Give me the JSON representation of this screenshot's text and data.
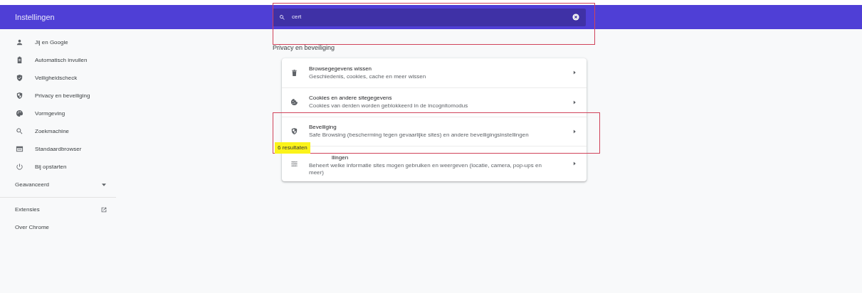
{
  "header": {
    "title": "Instellingen",
    "search": {
      "value": "cert",
      "highlighted": true
    }
  },
  "sidebar": {
    "items": [
      {
        "label": "Jij en Google"
      },
      {
        "label": "Automatisch invullen"
      },
      {
        "label": "Veiligheidscheck"
      },
      {
        "label": "Privacy en beveiliging"
      },
      {
        "label": "Vormgeving"
      },
      {
        "label": "Zoekmachine"
      },
      {
        "label": "Standaardbrowser"
      },
      {
        "label": "Bij opstarten"
      }
    ],
    "advanced": {
      "label": "Geavanceerd",
      "expanded": false
    },
    "links": [
      {
        "label": "Extensies",
        "external": true
      },
      {
        "label": "Over Chrome",
        "external": false
      }
    ]
  },
  "section": {
    "title": "Privacy en beveiliging",
    "rows": [
      {
        "title": "Browsegegevens wissen",
        "subtitle": "Geschiedenis, cookies, cache en meer wissen",
        "highlighted": false
      },
      {
        "title": "Cookies en andere sitegegevens",
        "subtitle": "Cookies van derden worden geblokkeerd in de incognitomodus",
        "highlighted": false
      },
      {
        "title": "Beveiliging",
        "subtitle": "Safe Browsing (bescherming tegen gevaarlijke sites) en andere beveiligingsinstellingen",
        "highlighted": true
      },
      {
        "title": "llingen",
        "subtitle": "Beheert welke informatie sites mogen gebruiken en weergeven (locatie, camera, pop-ups en meer)",
        "highlighted": false
      }
    ]
  },
  "results_bubble": {
    "text": "6 resultaten"
  }
}
